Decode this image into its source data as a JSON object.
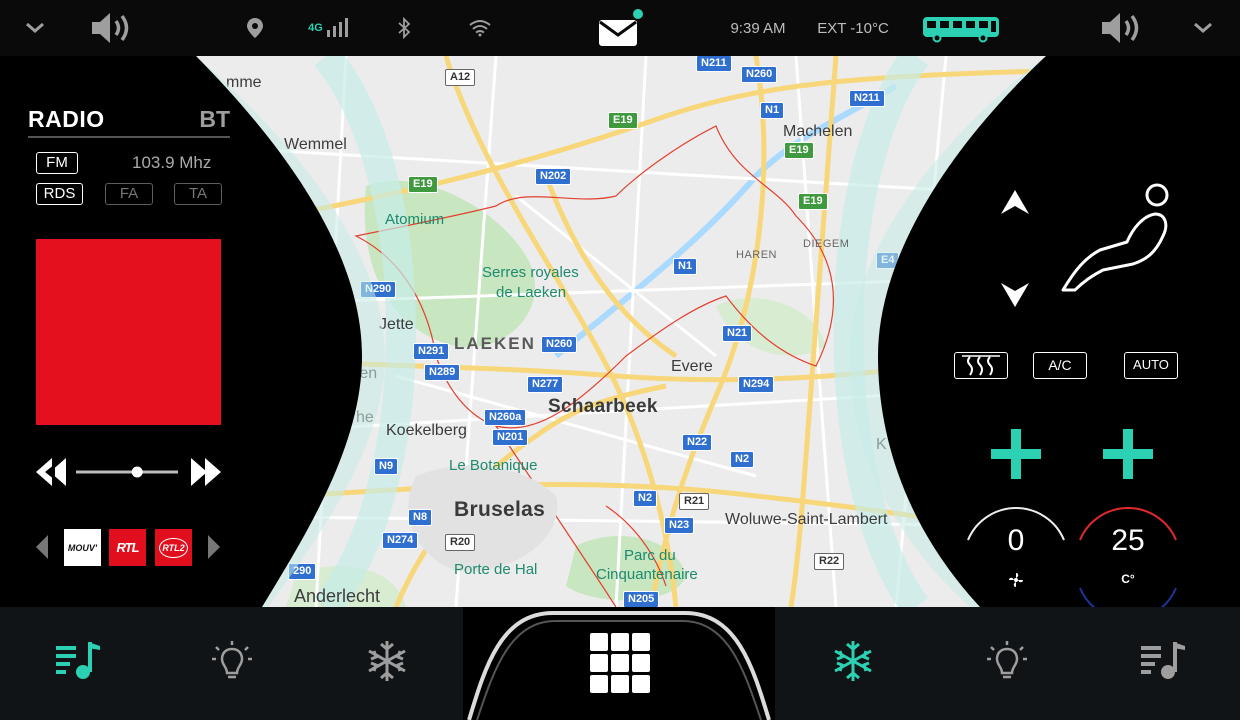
{
  "status_bar": {
    "network": "4G",
    "time": "9:39 AM",
    "exterior_temp": "EXT -10°C",
    "accent_color": "#2bd1b2",
    "icons": [
      "chevron-down-icon",
      "volume-icon",
      "location-pin-icon",
      "signal-icon",
      "bluetooth-icon",
      "wifi-icon",
      "mail-icon",
      "bus-icon",
      "volume-icon",
      "chevron-down-icon"
    ]
  },
  "map": {
    "labels": {
      "mme": "mme",
      "wemmel": "Wemmel",
      "atomium": "Atomium",
      "serres": "Serres royales",
      "serres2": "de Laeken",
      "jette": "Jette",
      "laeken": "LAEKEN",
      "ren": "ren",
      "he": "he",
      "koekelberg": "Koekelberg",
      "schaarbeek": "Schaarbeek",
      "botanique": "Le Botanique",
      "bruselas": "Bruselas",
      "porte_hal": "Porte de Hal",
      "parc": "Parc du",
      "parc2": "Cinquantenaire",
      "anderlecht": "Anderlecht",
      "evere": "Evere",
      "woluwe": "Woluwe-Saint-Lambert",
      "machelen": "Machelen",
      "haren": "HAREN",
      "diegem": "DIEGEM",
      "k": "K"
    },
    "roads": [
      "A12",
      "N211",
      "N260",
      "N1",
      "N211",
      "E19",
      "E19",
      "N202",
      "E19",
      "E19",
      "N290",
      "N291",
      "N260",
      "N289",
      "N277",
      "N21",
      "N294",
      "N260a",
      "N201",
      "N22",
      "N9",
      "N2",
      "R21",
      "N2",
      "N23",
      "N8",
      "N274",
      "R20",
      "R22",
      "N205",
      "290",
      "E4",
      "N1"
    ]
  },
  "radio": {
    "title": "RADIO",
    "bt": "BT",
    "band": "FM",
    "frequency": "103.9 Mhz",
    "rds": "RDS",
    "fa": "FA",
    "ta": "TA",
    "artwork_color": "#e5101e",
    "slider_position": 0.6,
    "stations": [
      "MOUV'",
      "RTL",
      "RTL2"
    ]
  },
  "climate": {
    "buttons": {
      "defrost": "rear-defrost-icon",
      "ac": "A/C",
      "auto": "AUTO"
    },
    "fan_speed": "0",
    "temperature": "25",
    "temp_unit": "C°"
  },
  "bottom_nav": [
    "music-icon",
    "light-bulb-icon",
    "snowflake-icon",
    "app-grid-icon",
    "snowflake-icon",
    "light-bulb-icon",
    "music-icon"
  ]
}
